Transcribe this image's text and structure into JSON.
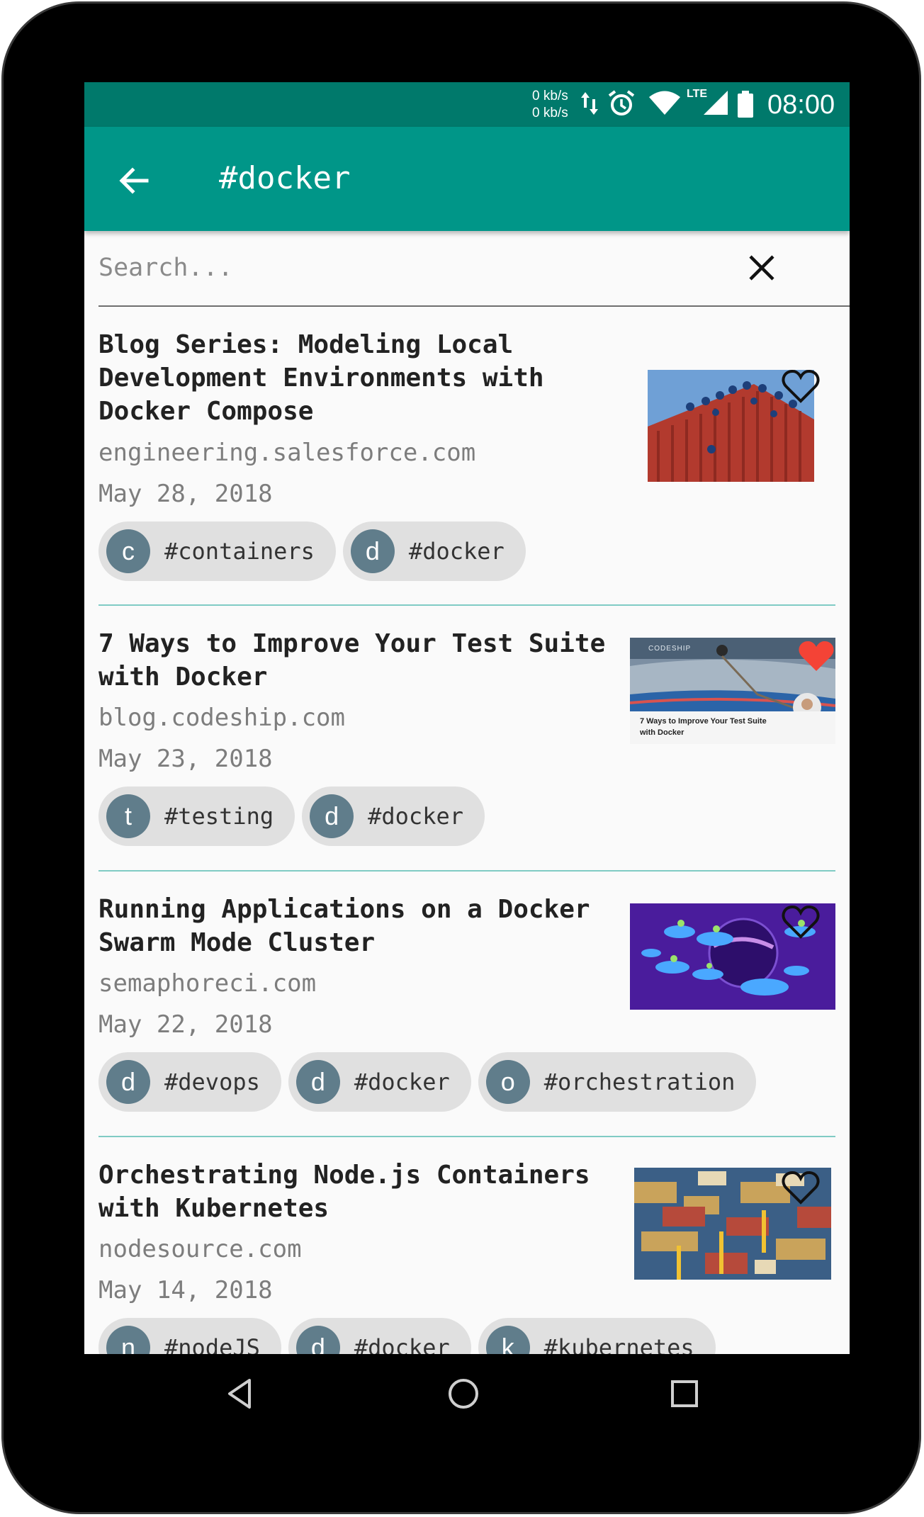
{
  "statusbar": {
    "speed_up": "0 kb/s",
    "speed_down": "0 kb/s",
    "network": "LTE",
    "time": "08:00"
  },
  "appbar": {
    "title": "#docker",
    "back_icon": "arrow-back-icon"
  },
  "search": {
    "placeholder": "Search...",
    "value": "",
    "clear_icon": "close-icon"
  },
  "articles": [
    {
      "title": "Blog Series: Modeling Local Development Environments with Docker Compose",
      "domain": "engineering.salesforce.com",
      "date": "May 28, 2018",
      "favorite": false,
      "tags": [
        {
          "initial": "c",
          "label": "#containers"
        },
        {
          "initial": "d",
          "label": "#docker"
        }
      ]
    },
    {
      "title": "7 Ways to Improve Your Test Suite with Docker",
      "domain": "blog.codeship.com",
      "date": "May 23, 2018",
      "favorite": true,
      "thumb_brand": "CODESHIP",
      "thumb_caption_1": "7 Ways to Improve Your Test Suite",
      "thumb_caption_2": "with Docker",
      "tags": [
        {
          "initial": "t",
          "label": "#testing"
        },
        {
          "initial": "d",
          "label": "#docker"
        }
      ]
    },
    {
      "title": "Running Applications on a Docker Swarm Mode Cluster",
      "domain": "semaphoreci.com",
      "date": "May 22, 2018",
      "favorite": false,
      "tags": [
        {
          "initial": "d",
          "label": "#devops"
        },
        {
          "initial": "d",
          "label": "#docker"
        },
        {
          "initial": "o",
          "label": "#orchestration"
        }
      ]
    },
    {
      "title": "Orchestrating Node.js Containers with Kubernetes",
      "domain": "nodesource.com",
      "date": "May 14, 2018",
      "favorite": false,
      "tags": [
        {
          "initial": "n",
          "label": "#nodeJS"
        },
        {
          "initial": "d",
          "label": "#docker"
        },
        {
          "initial": "k",
          "label": "#kubernetes"
        }
      ]
    }
  ],
  "colors": {
    "primary": "#009688",
    "primary_dark": "#00796b",
    "chip_avatar": "#607d8b",
    "favorite_active": "#f44336",
    "divider": "#80cbc4"
  },
  "navbar": {
    "back_icon": "nav-back-icon",
    "home_icon": "nav-home-icon",
    "recents_icon": "nav-recents-icon"
  }
}
